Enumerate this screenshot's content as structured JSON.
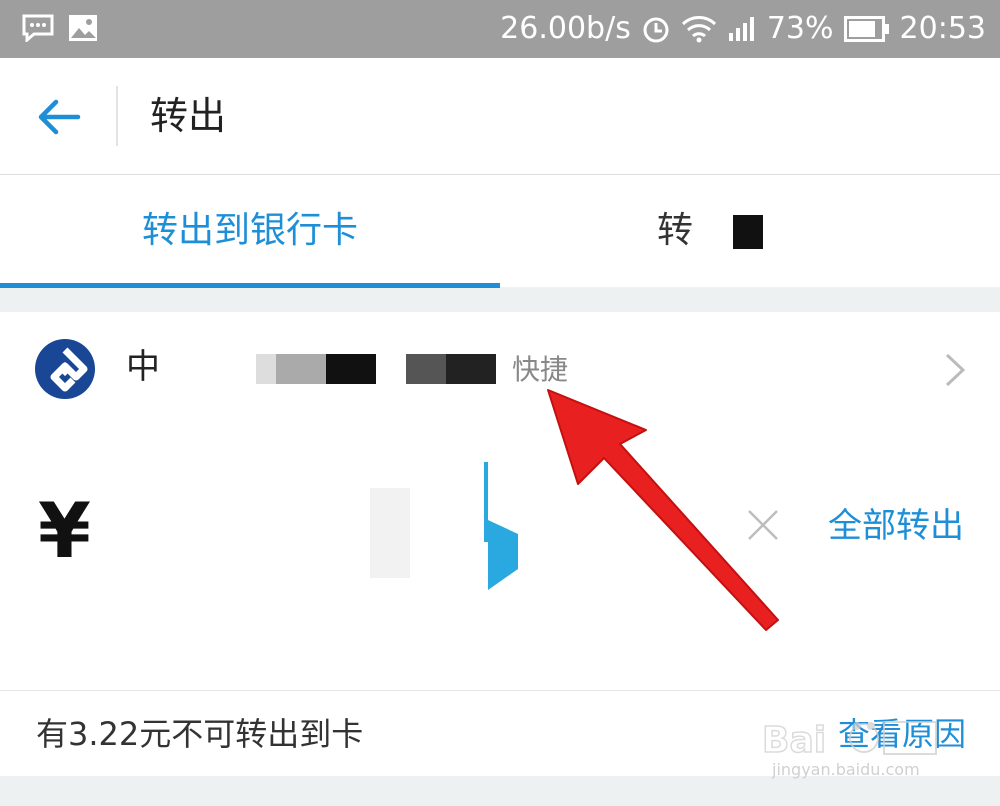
{
  "status_bar": {
    "speed": "26.00b/s",
    "battery": "73%",
    "time": "20:53"
  },
  "nav": {
    "title": "转出"
  },
  "tabs": [
    {
      "label": "转出到银行卡"
    },
    {
      "label": "转"
    }
  ],
  "bank_card": {
    "name": "中",
    "tag": "快捷"
  },
  "amount": {
    "currency_symbol": "¥",
    "all_out_label": "全部转出"
  },
  "notice": {
    "text": "有3.22元不可转出到卡",
    "link": "查看原因"
  },
  "watermark": {
    "brand": "Bai",
    "site": "jingyan.baidu.com"
  },
  "colors": {
    "accent": "#1e8fd7",
    "annotation_arrow": "#e82020"
  }
}
